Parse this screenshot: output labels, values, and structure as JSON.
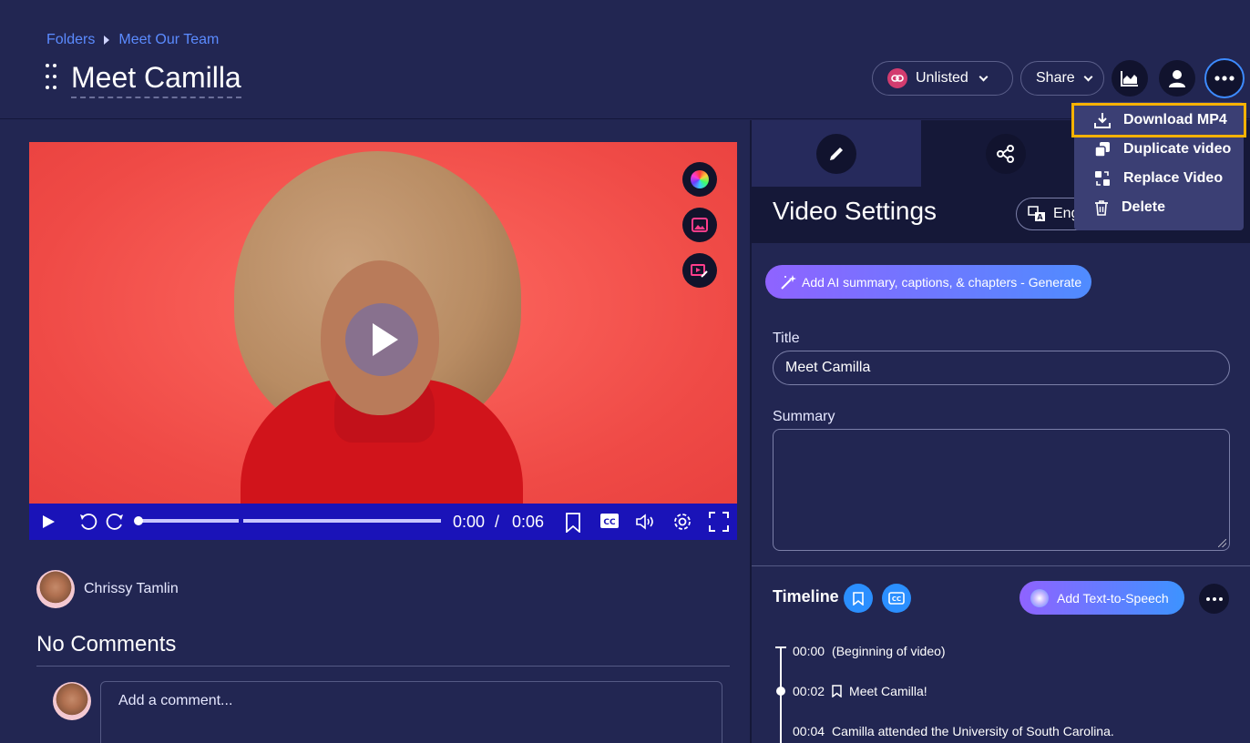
{
  "breadcrumb": {
    "root": "Folders",
    "current": "Meet Our Team"
  },
  "page": {
    "title": "Meet Camilla"
  },
  "toolbar": {
    "visibility_label": "Unlisted",
    "share_label": "Share",
    "icons": [
      "analytics-icon",
      "user-icon",
      "more-icon"
    ]
  },
  "more_menu": {
    "items": [
      {
        "label": "Download MP4",
        "icon": "download-icon"
      },
      {
        "label": "Duplicate video",
        "icon": "duplicate-icon"
      },
      {
        "label": "Replace Video",
        "icon": "replace-icon"
      },
      {
        "label": "Delete",
        "icon": "trash-icon"
      }
    ]
  },
  "player": {
    "current_time": "0:00",
    "separator": "/",
    "duration": "0:06"
  },
  "author": {
    "name": "Chrissy Tamlin"
  },
  "comments": {
    "heading": "No Comments",
    "placeholder": "Add a comment..."
  },
  "settings": {
    "title": "Video Settings",
    "language_label": "Eng",
    "ai_button": "Add AI summary, captions, & chapters - Generate",
    "title_label": "Title",
    "title_value": "Meet Camilla",
    "summary_label": "Summary",
    "summary_value": ""
  },
  "timeline": {
    "heading": "Timeline",
    "tts_button": "Add Text-to-Speech",
    "entries": [
      {
        "time": "00:00",
        "text": "(Beginning of video)"
      },
      {
        "time": "00:02",
        "text": "Meet Camilla!"
      },
      {
        "time": "00:04",
        "text": "Camilla attended the University of South Carolina."
      }
    ]
  },
  "colors": {
    "background": "#222652",
    "dark_panel": "#151838",
    "accent_blue": "#2b8fff",
    "highlight": "#f7b200",
    "player_bar": "#1a13b8"
  }
}
